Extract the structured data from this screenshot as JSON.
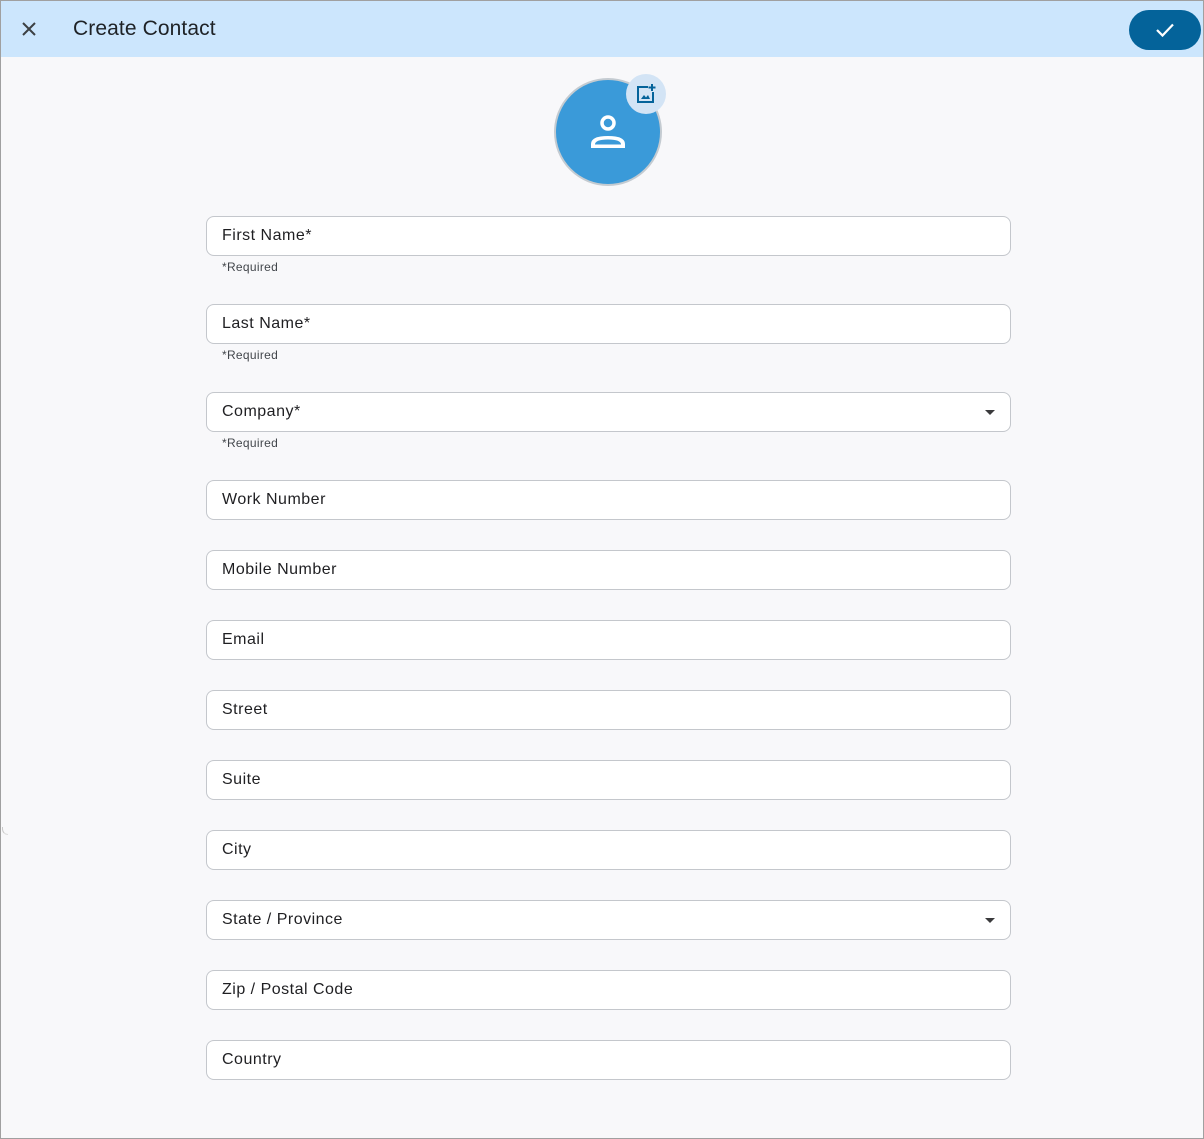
{
  "header": {
    "title": "Create Contact",
    "close_icon": "close-icon",
    "save_icon": "check-icon"
  },
  "avatar": {
    "icon": "person-icon",
    "add_photo_icon": "add-photo-icon"
  },
  "form": {
    "fields": [
      {
        "label": "First Name*",
        "value": "",
        "helper": "*Required",
        "type": "text"
      },
      {
        "label": "Last Name*",
        "value": "",
        "helper": "*Required",
        "type": "text"
      },
      {
        "label": "Company*",
        "value": "",
        "helper": "*Required",
        "type": "select"
      },
      {
        "label": "Work Number",
        "value": "",
        "type": "text"
      },
      {
        "label": "Mobile Number",
        "value": "",
        "type": "text"
      },
      {
        "label": "Email",
        "value": "",
        "type": "text"
      },
      {
        "label": "Street",
        "value": "",
        "type": "text"
      },
      {
        "label": "Suite",
        "value": "",
        "type": "text"
      },
      {
        "label": "City",
        "value": "",
        "type": "text"
      },
      {
        "label": "State / Province",
        "value": "",
        "type": "select"
      },
      {
        "label": "Zip / Postal Code",
        "value": "",
        "type": "text"
      },
      {
        "label": "Country",
        "value": "",
        "type": "text"
      }
    ]
  },
  "colors": {
    "header_bg": "#cce6fd",
    "primary": "#04639a",
    "avatar_bg": "#3a9ad9"
  }
}
